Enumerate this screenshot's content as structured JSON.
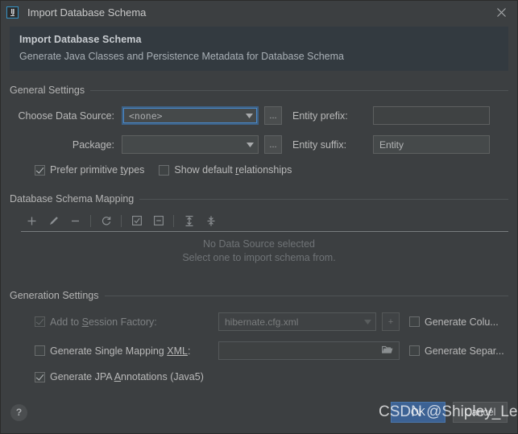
{
  "window": {
    "title": "Import Database Schema",
    "app_icon": "intellij-idea-icon",
    "close_icon": "close-icon"
  },
  "banner": {
    "title": "Import Database Schema",
    "subtitle": "Generate Java Classes and Persistence Metadata for Database Schema"
  },
  "general_settings": {
    "group_label": "General Settings",
    "data_source": {
      "label": "Choose Data Source:",
      "value": "<none>",
      "browse_label": "...",
      "focused": true
    },
    "package": {
      "label": "Package:",
      "value": "",
      "browse_label": "..."
    },
    "entity_prefix": {
      "label": "Entity prefix:",
      "value": ""
    },
    "entity_suffix": {
      "label": "Entity suffix:",
      "value": "Entity"
    },
    "prefer_primitive_types": {
      "label_before": "Prefer primitive ",
      "label_mnemonic": "t",
      "label_after": "ypes",
      "checked": true
    },
    "show_default_relationships": {
      "label_before": "Show default ",
      "label_mnemonic": "r",
      "label_after": "elationships",
      "checked": false
    }
  },
  "schema_mapping": {
    "group_label": "Database Schema Mapping",
    "toolbar": [
      {
        "name": "add-icon",
        "glyph": "+"
      },
      {
        "name": "edit-icon",
        "glyph": "pencil"
      },
      {
        "name": "remove-icon",
        "glyph": "-"
      },
      {
        "name": "refresh-icon",
        "glyph": "refresh"
      },
      {
        "name": "select-all-icon",
        "glyph": "checked-box"
      },
      {
        "name": "deselect-all-icon",
        "glyph": "minus-box"
      },
      {
        "name": "expand-all-icon",
        "glyph": "expand"
      },
      {
        "name": "collapse-all-icon",
        "glyph": "collapse"
      }
    ],
    "empty_line1": "No Data Source selected",
    "empty_line2": "Select one to import schema from."
  },
  "generation_settings": {
    "group_label": "Generation Settings",
    "add_to_session_factory": {
      "label_before": "Add to ",
      "label_mnemonic": "S",
      "label_after": "ession Factory:",
      "checked": true,
      "disabled": true
    },
    "session_factory_file": {
      "value": "hibernate.cfg.xml",
      "disabled": true
    },
    "add_config_button": "+",
    "generate_columns": {
      "label": "Generate Colu...",
      "checked": false
    },
    "generate_single_mapping_xml": {
      "label_before": "Generate Single Mapping ",
      "label_mnemonic": "XML",
      "label_after": ":",
      "checked": false
    },
    "mapping_xml_path": {
      "value": "",
      "browse_icon": "folder-icon"
    },
    "generate_separate": {
      "label": "Generate Separ...",
      "checked": false
    },
    "generate_jpa_annotations": {
      "label_before": "Generate JPA ",
      "label_mnemonic": "A",
      "label_after": "nnotations (Java5)",
      "checked": true
    }
  },
  "footer": {
    "help_label": "?",
    "ok_label": "OK",
    "cancel_label": "Cancel"
  },
  "watermark": {
    "text": "CSDN @Shipley_Leo"
  },
  "colors": {
    "background": "#3c3f41",
    "banner": "#333a40",
    "accent_blue": "#3c6294",
    "focus_blue": "#4a88c7",
    "field": "#45494a",
    "text": "#b9b9b9",
    "muted_text": "#6f7376"
  }
}
